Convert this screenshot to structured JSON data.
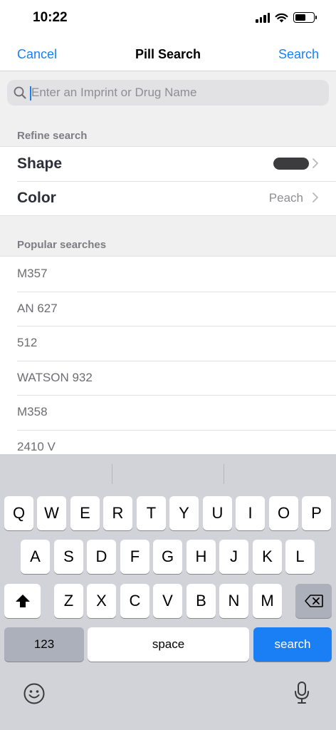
{
  "status_bar": {
    "time": "10:22",
    "battery_level": 0.6
  },
  "nav": {
    "cancel_label": "Cancel",
    "title": "Pill Search",
    "search_label": "Search"
  },
  "search": {
    "placeholder": "Enter an Imprint or Drug Name",
    "value": ""
  },
  "refine": {
    "header": "Refine search",
    "shape": {
      "label": "Shape",
      "value_color": "#3c3c3e"
    },
    "color": {
      "label": "Color",
      "value": "Peach"
    }
  },
  "popular": {
    "header": "Popular searches",
    "items": [
      "M357",
      "AN 627",
      "512",
      "WATSON 932",
      "M358",
      "2410 V"
    ]
  },
  "keyboard": {
    "row1": [
      "Q",
      "W",
      "E",
      "R",
      "T",
      "Y",
      "U",
      "I",
      "O",
      "P"
    ],
    "row2": [
      "A",
      "S",
      "D",
      "F",
      "G",
      "H",
      "J",
      "K",
      "L"
    ],
    "row3": [
      "Z",
      "X",
      "C",
      "V",
      "B",
      "N",
      "M"
    ],
    "numbers_label": "123",
    "space_label": "space",
    "search_label": "search"
  },
  "colors": {
    "accent": "#1a7ff5",
    "keyboard_bg": "#d1d3d9"
  }
}
